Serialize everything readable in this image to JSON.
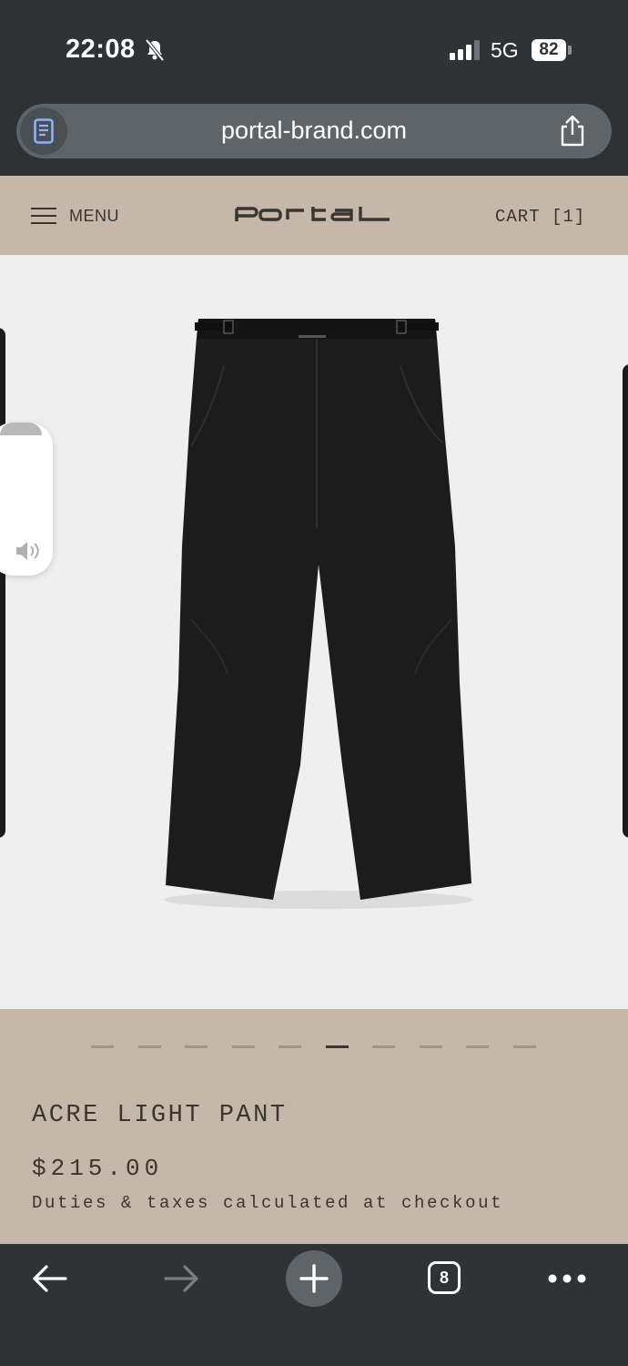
{
  "status_bar": {
    "time": "22:08",
    "network": "5G",
    "battery": "82"
  },
  "browser": {
    "url": "portal-brand.com",
    "tab_count": "8"
  },
  "site_header": {
    "menu_label": "MENU",
    "cart_label": "CART [1]"
  },
  "product": {
    "name": "ACRE LIGHT PANT",
    "price": "$215.00",
    "taxes_note": "Duties & taxes calculated at checkout",
    "image_count": 10,
    "active_image_index": 5
  },
  "colors": {
    "header_bg": "#c5b8aa",
    "chrome_bg": "#303336",
    "text_dark": "#3b3530",
    "gallery_bg": "#efefef"
  },
  "icons": [
    "bell-slash-icon",
    "signal-icon",
    "reader-icon",
    "share-icon",
    "hamburger-icon",
    "portal-logo",
    "back-arrow-icon",
    "forward-arrow-icon",
    "plus-icon",
    "tabs-icon",
    "more-icon",
    "volume-icon"
  ]
}
